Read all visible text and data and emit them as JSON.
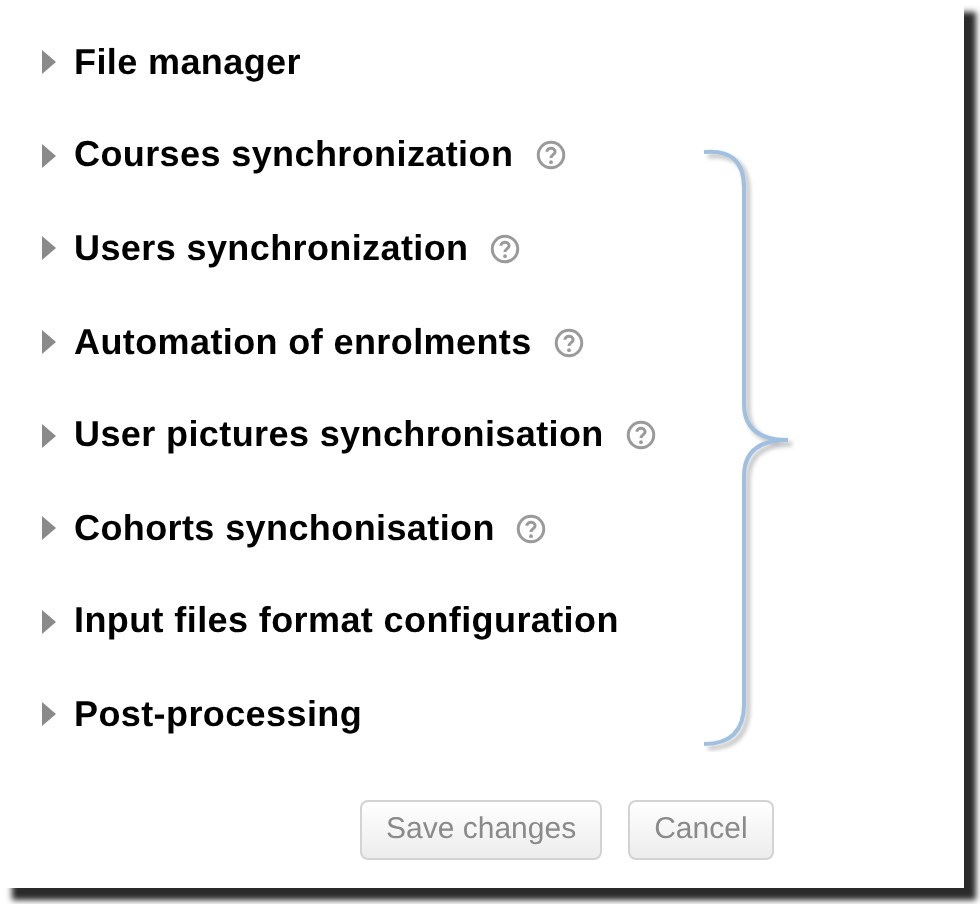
{
  "sections": [
    {
      "label": "File manager",
      "expanded": false,
      "help": false
    },
    {
      "label": "Courses synchronization",
      "expanded": false,
      "help": true
    },
    {
      "label": "Users synchronization",
      "expanded": false,
      "help": true
    },
    {
      "label": "Automation of enrolments",
      "expanded": false,
      "help": true
    },
    {
      "label": "User pictures synchronisation",
      "expanded": false,
      "help": true
    },
    {
      "label": "Cohorts synchonisation",
      "expanded": false,
      "help": true
    },
    {
      "label": "Input files format configuration",
      "expanded": false,
      "help": false
    },
    {
      "label": "Post-processing",
      "expanded": false,
      "help": false
    }
  ],
  "buttons": [
    "Save changes",
    "Cancel"
  ]
}
